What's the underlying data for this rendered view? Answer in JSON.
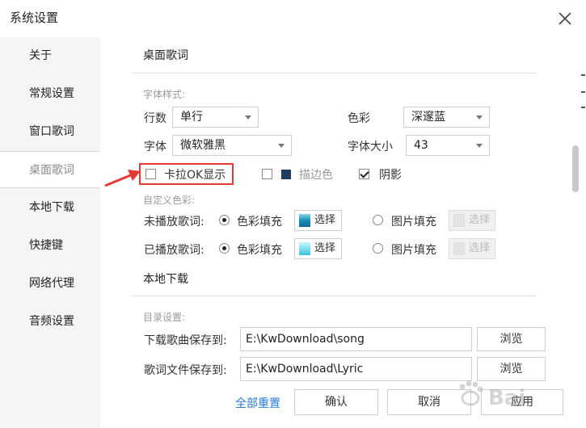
{
  "window": {
    "title": "系统设置"
  },
  "sidebar": {
    "items": [
      {
        "label": "关于"
      },
      {
        "label": "常规设置"
      },
      {
        "label": "窗口歌词"
      },
      {
        "label": "桌面歌词"
      },
      {
        "label": "本地下载"
      },
      {
        "label": "快捷键"
      },
      {
        "label": "网络代理"
      },
      {
        "label": "音频设置"
      }
    ],
    "active_index": 3
  },
  "desktop_lyrics": {
    "title": "桌面歌词",
    "font_style_label": "字体样式:",
    "rows_label": "行数",
    "rows_value": "单行",
    "color_label": "色彩",
    "color_value": "深邃蓝",
    "font_label": "字体",
    "font_value": "微软雅黑",
    "font_size_label": "字体大小",
    "font_size_value": "43",
    "karaoke_label": "卡拉OK显示",
    "karaoke_checked": false,
    "outline_label": "描边色",
    "outline_checked": false,
    "outline_color": "#1e3a5f",
    "shadow_label": "阴影",
    "shadow_checked": true,
    "custom_color_label": "自定义色彩:",
    "unplayed_label": "未播放歌词:",
    "played_label": "已播放歌词:",
    "color_fill_label": "色彩填充",
    "image_fill_label": "图片填充",
    "select_label": "选择",
    "unplayed_fill_color": "#1a8fb8",
    "played_fill_color": "#7fe0ef"
  },
  "local_download": {
    "title": "本地下载",
    "dir_label": "目录设置:",
    "song_label": "下载歌曲保存到:",
    "song_path": "E:\\KwDownload\\song",
    "lyric_label": "歌词文件保存到:",
    "lyric_path": "E:\\KwDownload\\Lyric",
    "browse_label": "浏览"
  },
  "footer": {
    "reset_label": "全部重置",
    "ok_label": "确认",
    "cancel_label": "取消",
    "apply_label": "应用"
  },
  "annotation": {
    "color": "#e53935"
  },
  "watermark": {
    "text": "Baidu经验"
  }
}
